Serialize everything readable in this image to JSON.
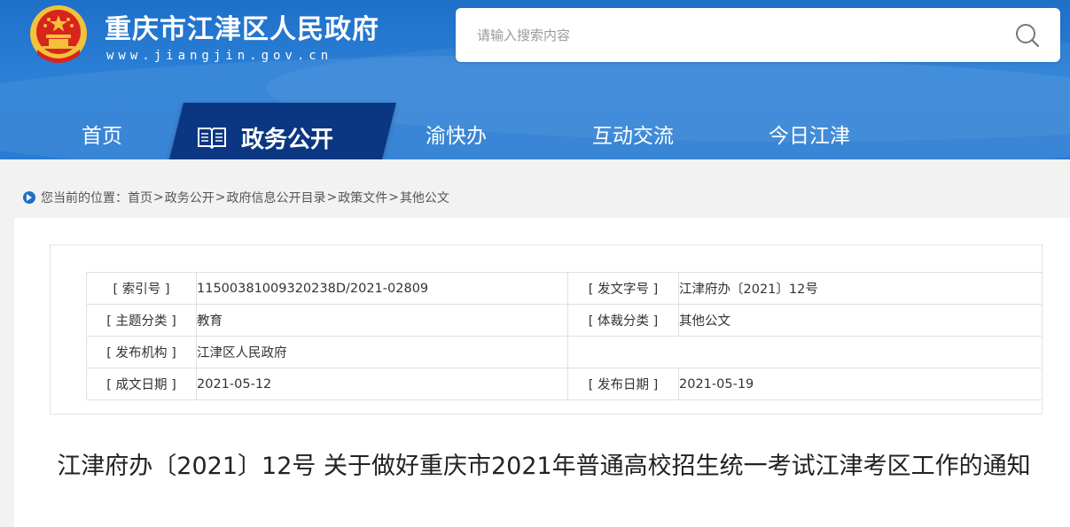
{
  "header": {
    "site_title": "重庆市江津区人民政府",
    "site_url": "www.jiangjin.gov.cn",
    "search_placeholder": "请输入搜索内容"
  },
  "nav": {
    "items": [
      {
        "label": "首页"
      },
      {
        "label": "政务公开",
        "active": true
      },
      {
        "label": "渝快办"
      },
      {
        "label": "互动交流"
      },
      {
        "label": "今日江津"
      }
    ]
  },
  "breadcrumb": {
    "prefix": "您当前的位置：",
    "items": [
      "首页",
      "政务公开",
      "政府信息公开目录",
      "政策文件",
      "其他公文"
    ],
    "separator": ">"
  },
  "meta": {
    "index_no_label": "[ 索引号 ]",
    "index_no": "11500381009320238D/2021-02809",
    "doc_no_label": "[ 发文字号 ]",
    "doc_no": "江津府办〔2021〕12号",
    "topic_label": "[ 主题分类 ]",
    "topic": "教育",
    "genre_label": "[ 体裁分类 ]",
    "genre": "其他公文",
    "issuer_label": "[ 发布机构 ]",
    "issuer": "江津区人民政府",
    "written_date_label": "[ 成文日期 ]",
    "written_date": "2021-05-12",
    "publish_date_label": "[ 发布日期 ]",
    "publish_date": "2021-05-19"
  },
  "document": {
    "title": "江津府办〔2021〕12号 关于做好重庆市2021年普通高校招生统一考试江津考区工作的通知"
  },
  "colors": {
    "header_blue": "#2a7cd2",
    "nav_active": "#0b3682",
    "emblem_red": "#d8241d",
    "emblem_gold": "#f2c23a"
  }
}
